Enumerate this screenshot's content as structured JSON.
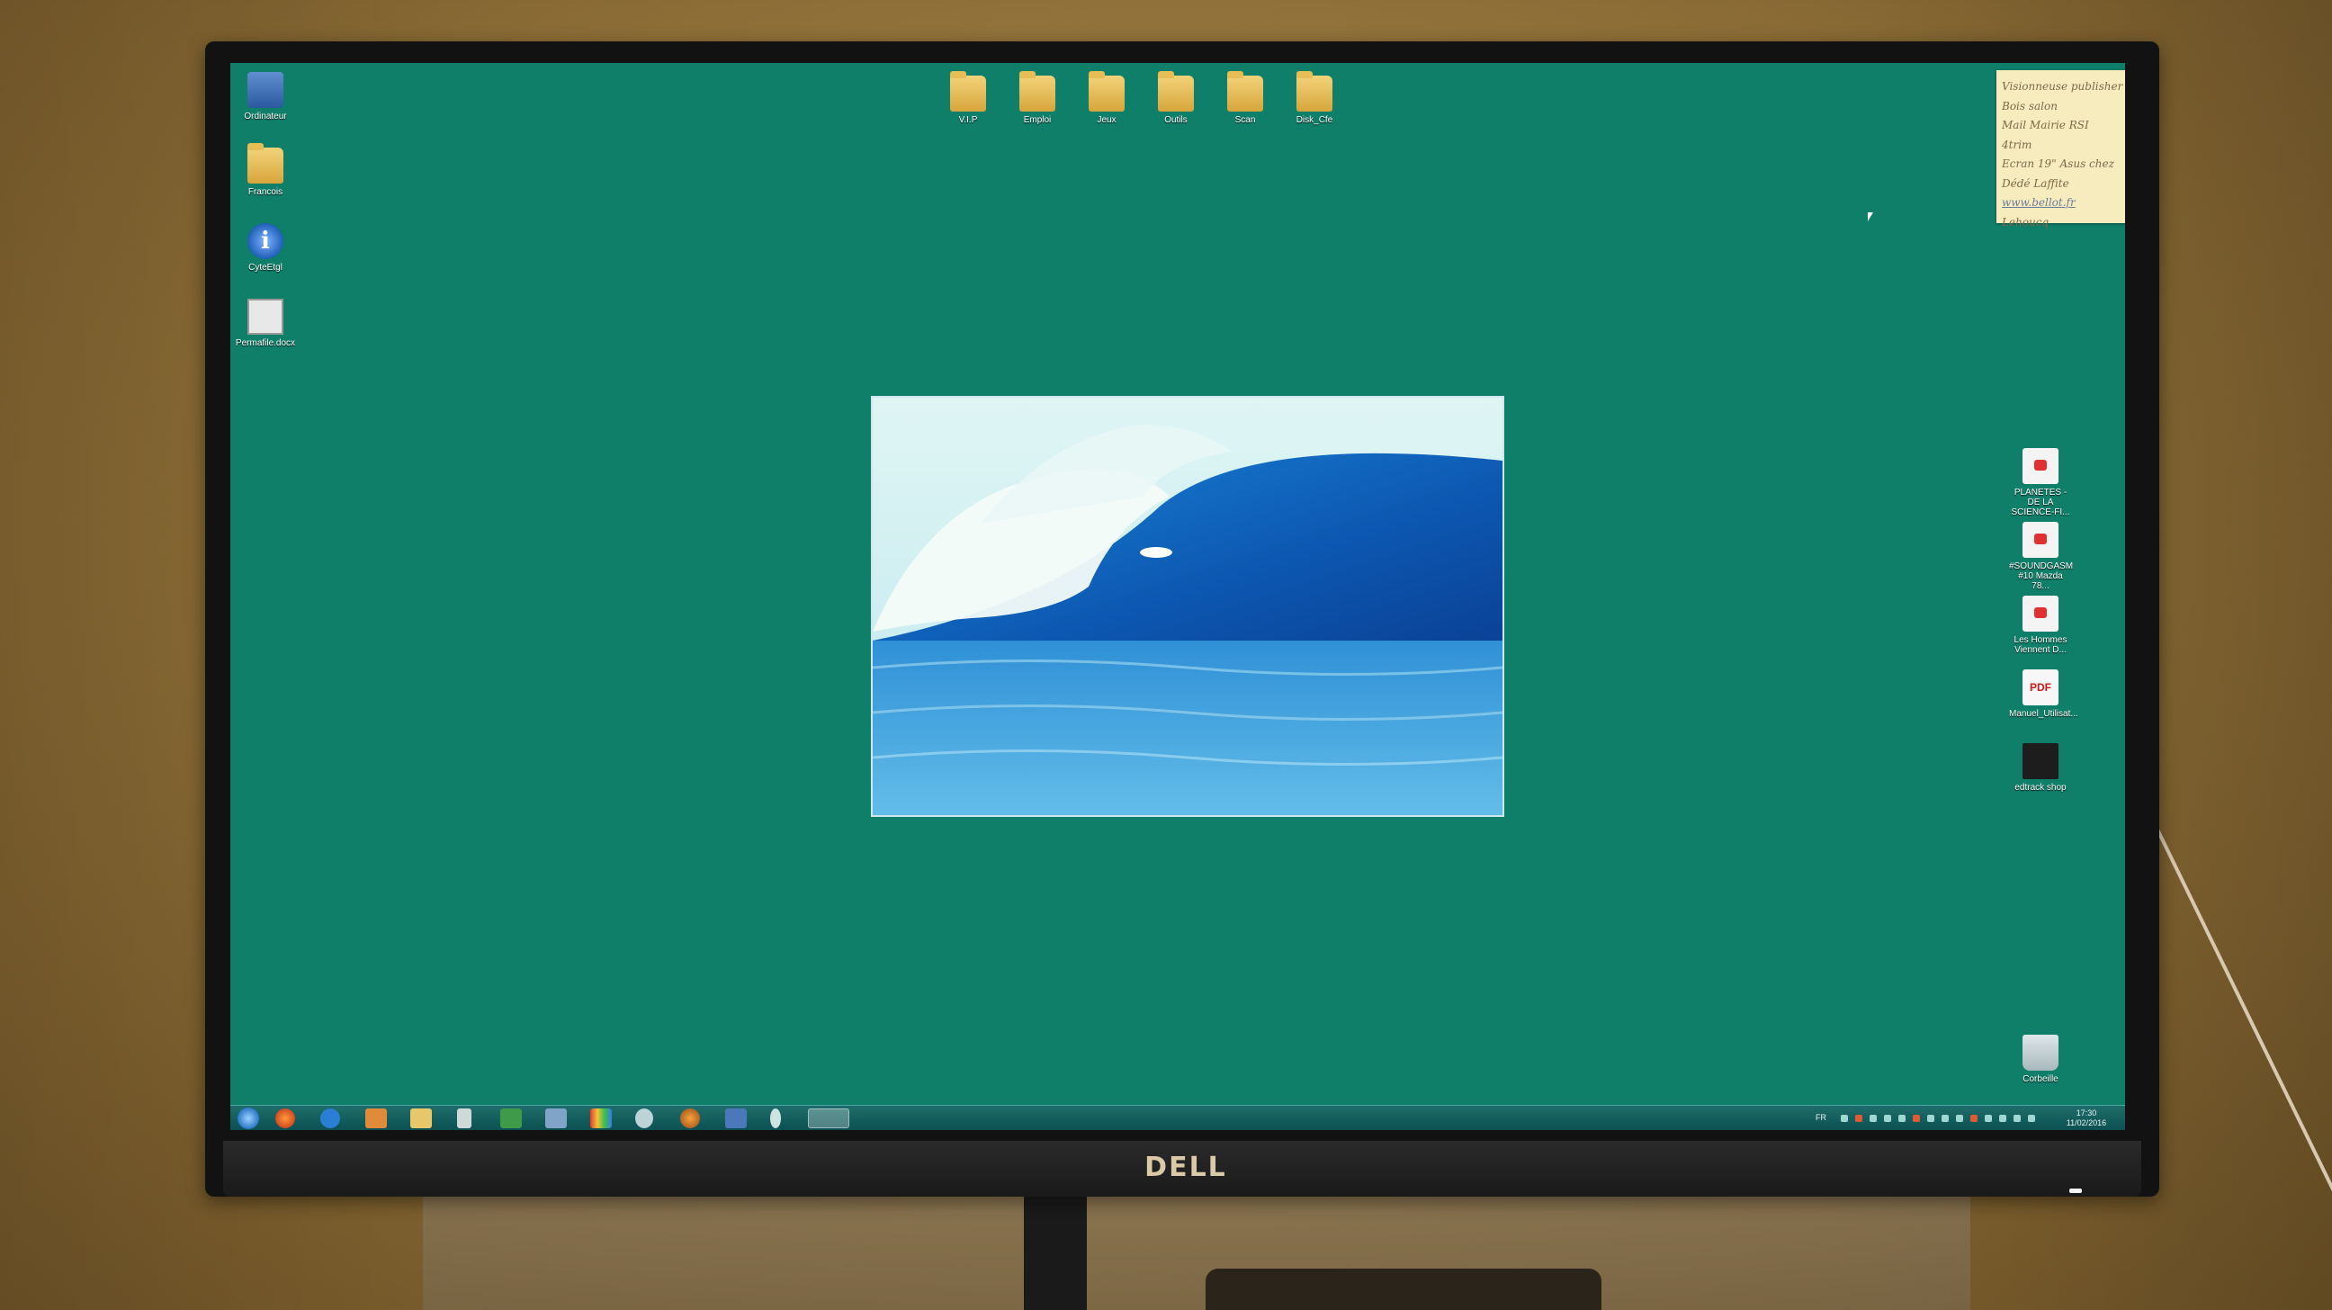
{
  "monitor": {
    "brand": "DELL"
  },
  "desktop": {
    "left_icons": [
      {
        "label": "Ordinateur",
        "icon": "computer-icon"
      },
      {
        "label": "Francois",
        "icon": "user-folder-icon"
      },
      {
        "label": "CyteEtgl",
        "icon": "info-icon"
      },
      {
        "label": "Permafile.docx",
        "icon": "document-icon"
      }
    ],
    "top_folders": [
      "V.I.P",
      "Emploi",
      "Jeux",
      "Outils",
      "Scan",
      "Disk_Cfe"
    ],
    "right_icons": [
      {
        "label": "PLANETES - DE LA SCIENCE-FI...",
        "icon": "media-shortcut-icon"
      },
      {
        "label": "#SOUNDGASM #10 Mazda 78...",
        "icon": "media-shortcut-icon"
      },
      {
        "label": "Les Hommes Viennent D...",
        "icon": "media-shortcut-icon"
      },
      {
        "label": "Manuel_Utilisat...",
        "icon": "pdf-icon"
      },
      {
        "label": "edtrack shop",
        "icon": "application-icon"
      }
    ],
    "recycle_bin": {
      "label": "Corbeille",
      "icon": "recycle-bin-icon"
    },
    "sticky_note": {
      "lines": [
        "Visionneuse publisher",
        "Bois salon",
        "Mail Mairie RSI",
        "4trim",
        "Ecran 19\" Asus chez",
        "Dédé Laffite",
        "www.bellot.fr",
        "Lehoucq"
      ],
      "link_index": 6
    }
  },
  "taskbar": {
    "buttons": [
      "firefox-icon",
      "internet-explorer-icon",
      "media-player-icon",
      "file-explorer-icon",
      "notepad-icon",
      "excel-icon",
      "window-icon",
      "color-app-icon",
      "chat-icon",
      "browser-icon",
      "network-icon",
      "moon-icon",
      "folder-window-icon"
    ],
    "active_index": 12,
    "tray_language": "FR",
    "clock": {
      "time": "17:30",
      "date": "11/02/2016"
    }
  }
}
